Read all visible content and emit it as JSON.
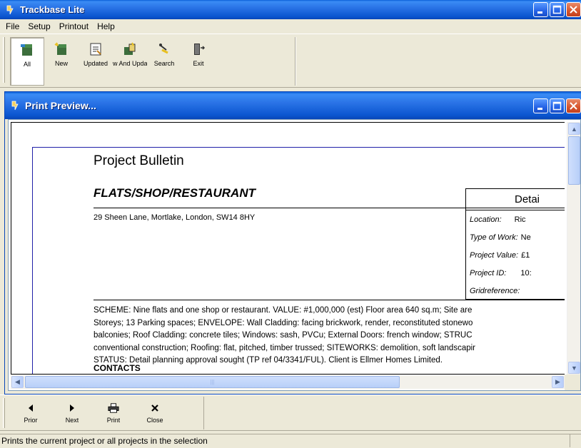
{
  "app": {
    "title": "Trackbase Lite"
  },
  "menu": [
    "File",
    "Setup",
    "Printout",
    "Help"
  ],
  "toolbar": [
    {
      "label": "All",
      "icon": "all-icon"
    },
    {
      "label": "New",
      "icon": "new-icon"
    },
    {
      "label": "Updated",
      "icon": "updated-icon"
    },
    {
      "label": "w And Updat",
      "icon": "new-and-updated-icon"
    },
    {
      "label": "Search",
      "icon": "search-icon"
    },
    {
      "label": "Exit",
      "icon": "exit-icon"
    }
  ],
  "preview": {
    "window_title": "Print Preview...",
    "bulletin_title": "Project Bulletin",
    "project_name": "FLATS/SHOP/RESTAURANT",
    "address": "29 Sheen Lane, Mortlake, London, SW14 8HY",
    "details_heading": "Detai",
    "details": [
      {
        "label": "Location:",
        "value": "Ric"
      },
      {
        "label": "Type of Work:",
        "value": "Ne"
      },
      {
        "label": "Project Value:",
        "value": "£1"
      },
      {
        "label": "Project ID:",
        "value": "10:"
      },
      {
        "label": "Gridreference:",
        "value": ""
      }
    ],
    "body_lines": [
      "SCHEME: Nine flats and one shop or restaurant.  VALUE: #1,000,000 (est)  Floor area 640 sq.m; Site are",
      "Storeys; 13 Parking spaces;  ENVELOPE: Wall Cladding: facing brickwork, render, reconstituted stonewo",
      "balconies; Roof Cladding: concrete tiles; Windows: sash, PVCu; External Doors: french window; STRUC",
      "conventional construction; Roofing: flat, pitched, timber trussed; SITEWORKS: demolition, soft landscapir",
      "STATUS: Detail planning approval sought (TP ref  04/3341/FUL).  Client is Ellmer Homes Limited."
    ],
    "contacts_heading": "CONTACTS"
  },
  "bottom_toolbar": [
    {
      "label": "Prior",
      "icon": "prior-arrow-icon",
      "glyph": "◀"
    },
    {
      "label": "Next",
      "icon": "next-arrow-icon",
      "glyph": "▶"
    },
    {
      "label": "Print",
      "icon": "printer-icon",
      "glyph": ""
    },
    {
      "label": "Close",
      "icon": "close-x-icon",
      "glyph": "✕"
    }
  ],
  "status": {
    "text": "Prints the current project or all projects in the selection"
  }
}
